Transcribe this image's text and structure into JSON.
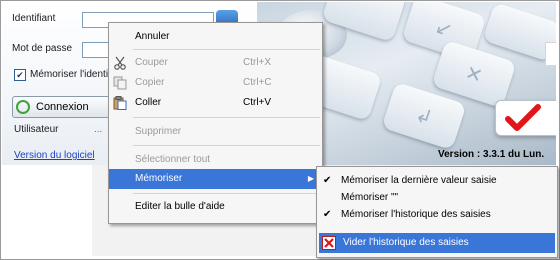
{
  "login": {
    "identifiant_label": "Identifiant",
    "mot_de_passe_label": "Mot de passe",
    "memoriser_label": "Mémoriser l'identi",
    "memoriser_checked": true,
    "connexion_button": "Connexion",
    "utilisateur_label": "Utilisateur",
    "utilisateur_value": "...",
    "version_link": "Version du logiciel",
    "version_text": "Version : 3.3.1 du Lun."
  },
  "context_menu": {
    "items": [
      {
        "label": "Annuler",
        "shortcut": "",
        "enabled": true
      },
      {
        "label": "Couper",
        "shortcut": "Ctrl+X",
        "enabled": false,
        "icon": "scissors-icon"
      },
      {
        "label": "Copier",
        "shortcut": "Ctrl+C",
        "enabled": false,
        "icon": "copy-icon"
      },
      {
        "label": "Coller",
        "shortcut": "Ctrl+V",
        "enabled": true,
        "icon": "paste-icon"
      },
      {
        "label": "Supprimer",
        "shortcut": "",
        "enabled": false
      },
      {
        "label": "Sélectionner tout",
        "shortcut": "",
        "enabled": false
      },
      {
        "label": "Mémoriser",
        "shortcut": "",
        "enabled": true,
        "selected": true,
        "has_submenu": true
      },
      {
        "label": "Editer la bulle d'aide",
        "shortcut": "",
        "enabled": true
      }
    ]
  },
  "submenu": {
    "items": [
      {
        "label": "Mémoriser la dernière valeur saisie",
        "checked": true
      },
      {
        "label": "Mémoriser \"\"",
        "checked": false
      },
      {
        "label": "Mémoriser l'historique des saisies",
        "checked": true
      },
      {
        "label": "Vider l'historique des saisies",
        "checked": false,
        "selected": true,
        "icon": "delete-icon"
      }
    ]
  },
  "colors": {
    "menu_highlight": "#3a76d8",
    "link": "#1e3fbf",
    "checkmark": "#e0161b"
  }
}
